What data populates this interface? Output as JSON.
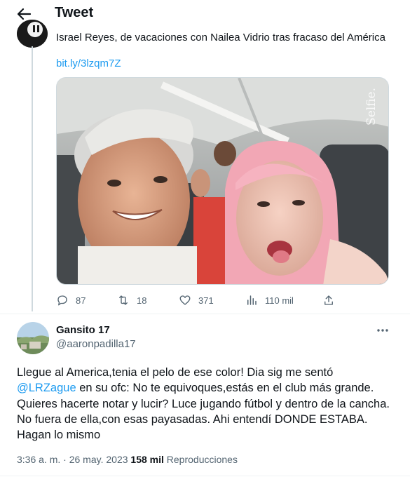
{
  "header": {
    "title": "Tweet",
    "back_icon": "arrow-left-icon"
  },
  "quoted_tweet": {
    "text": "Israel Reyes, de vacaciones con Nailea Vidrio tras fracaso del América",
    "link": "bit.ly/3lzqm7Z",
    "media_watermark": "Selfie.",
    "stats": {
      "replies": "87",
      "retweets": "18",
      "likes": "371",
      "views": "110 mil"
    }
  },
  "reply": {
    "name": "Gansito 17",
    "handle": "@aaronpadilla17",
    "text_before_mention": "Llegue al America,tenia el pelo de ese color! Dia sig me sentó ",
    "mention": "@LRZague",
    "text_after_mention": " en su ofc: No te equivoques,estás en el club más grande. Quieres hacerte notar y lucir? Luce jugando fútbol y dentro de la cancha. No fuera de ella,con esas payasadas. Ahi entendí DONDE ESTABA. Hagan lo mismo",
    "time": "3:36 a. m.",
    "separator": " · ",
    "date": "26 may. 2023",
    "views_count": "158 mil",
    "views_label": "Reproducciones"
  },
  "colors": {
    "accent": "#1d9bf0",
    "text": "#0f1419",
    "secondary": "#536471",
    "divider": "#eff3f4"
  }
}
